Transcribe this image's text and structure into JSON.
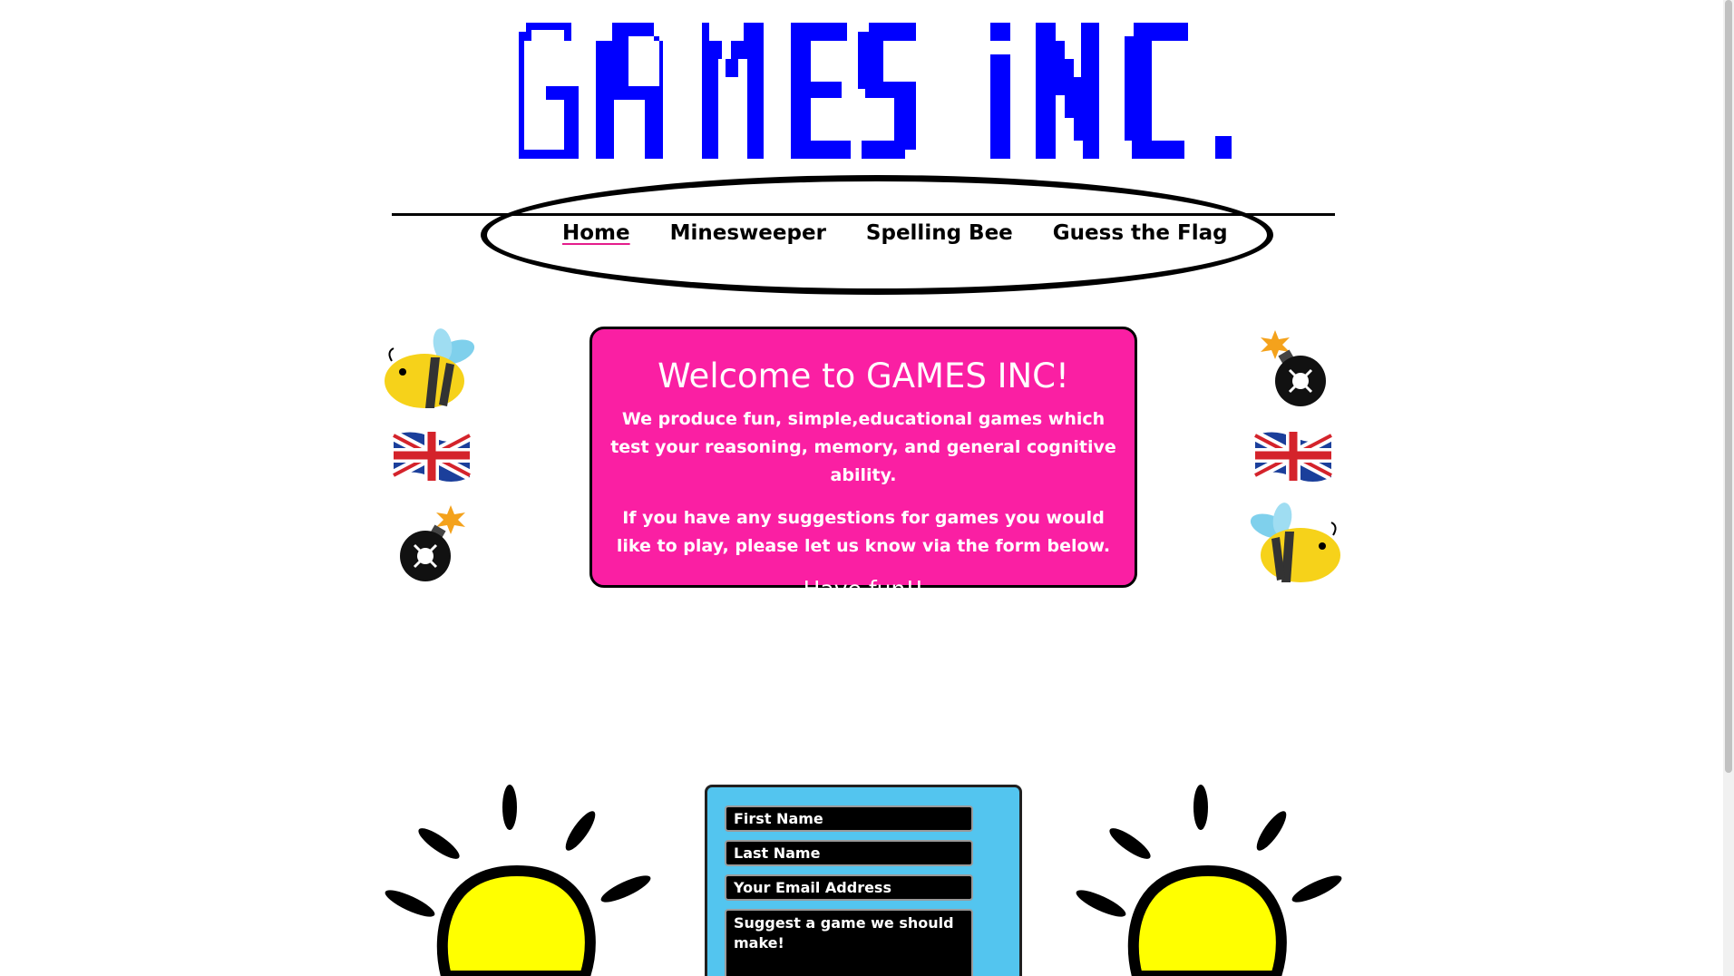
{
  "logo": {
    "text": "GAMES INC.",
    "color": "#0000ff"
  },
  "nav": {
    "items": [
      {
        "label": "Home",
        "active": true
      },
      {
        "label": "Minesweeper",
        "active": false
      },
      {
        "label": "Spelling Bee",
        "active": false
      },
      {
        "label": "Guess the Flag",
        "active": false
      }
    ]
  },
  "welcome": {
    "title": "Welcome to GAMES INC!",
    "para1": "We produce fun, simple,educational games which test your reasoning, memory, and general cognitive ability.",
    "para2": "If you have any suggestions for games you would like to play, please let us know via the form below.",
    "closing": "Have fun!!",
    "background": "#fa1fa3"
  },
  "side_icons": {
    "left": [
      "bee-icon",
      "uk-flag-icon",
      "bomb-icon"
    ],
    "right": [
      "bomb-icon",
      "uk-flag-icon",
      "bee-icon"
    ]
  },
  "form": {
    "first_name_placeholder": "First Name",
    "last_name_placeholder": "Last Name",
    "email_placeholder": "Your Email Address",
    "suggestion_placeholder": "Suggest a game we should make!",
    "background": "#53c5ef"
  },
  "decorations": [
    "lightbulb-icon",
    "lightbulb-icon"
  ]
}
